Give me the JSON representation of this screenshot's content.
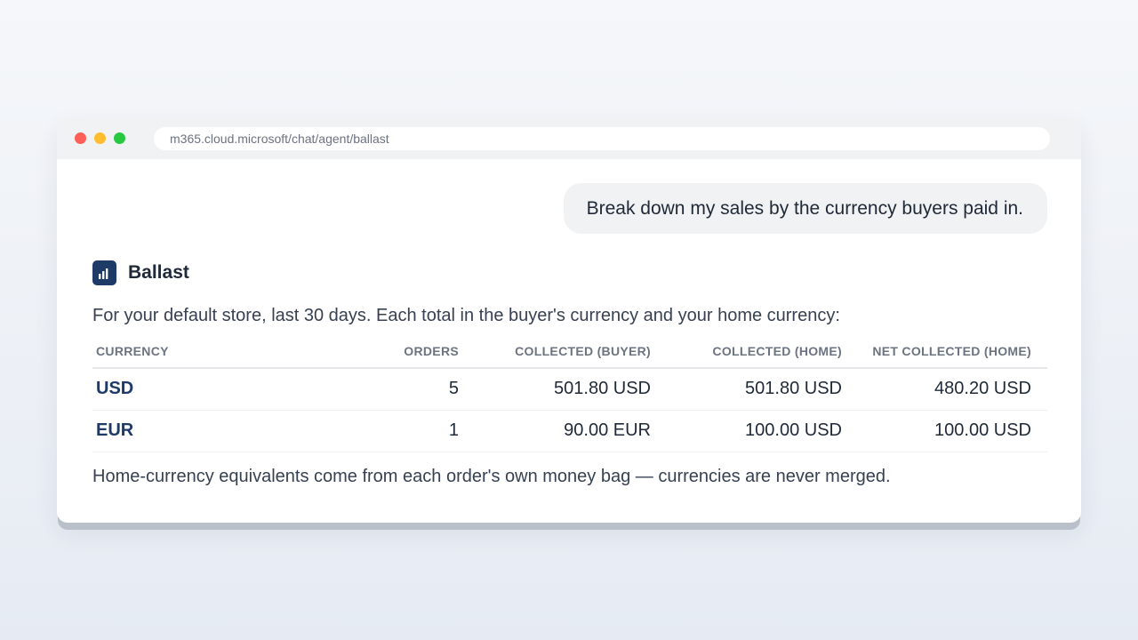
{
  "browser": {
    "url": "m365.cloud.microsoft/chat/agent/ballast"
  },
  "chat": {
    "user_message": "Break down my sales by the currency buyers paid in.",
    "agent": {
      "name": "Ballast",
      "logo_icon": "bar-chart-icon",
      "intro": "For your default store, last 30 days. Each total in the buyer's currency and your home currency:",
      "table": {
        "headers": [
          "CURRENCY",
          "ORDERS",
          "COLLECTED (BUYER)",
          "COLLECTED (HOME)",
          "NET COLLECTED (HOME)"
        ],
        "rows": [
          [
            "USD",
            "5",
            "501.80 USD",
            "501.80 USD",
            "480.20 USD"
          ],
          [
            "EUR",
            "1",
            "90.00 EUR",
            "100.00 USD",
            "100.00 USD"
          ]
        ]
      },
      "footnote": "Home-currency equivalents come from each order's own money bag — currencies are never merged."
    }
  },
  "colors": {
    "accent": "#1e3a66",
    "window_chrome": "#f1f2f3",
    "close": "#fe5f57",
    "minimize": "#febc2e",
    "maximize": "#28c840"
  }
}
